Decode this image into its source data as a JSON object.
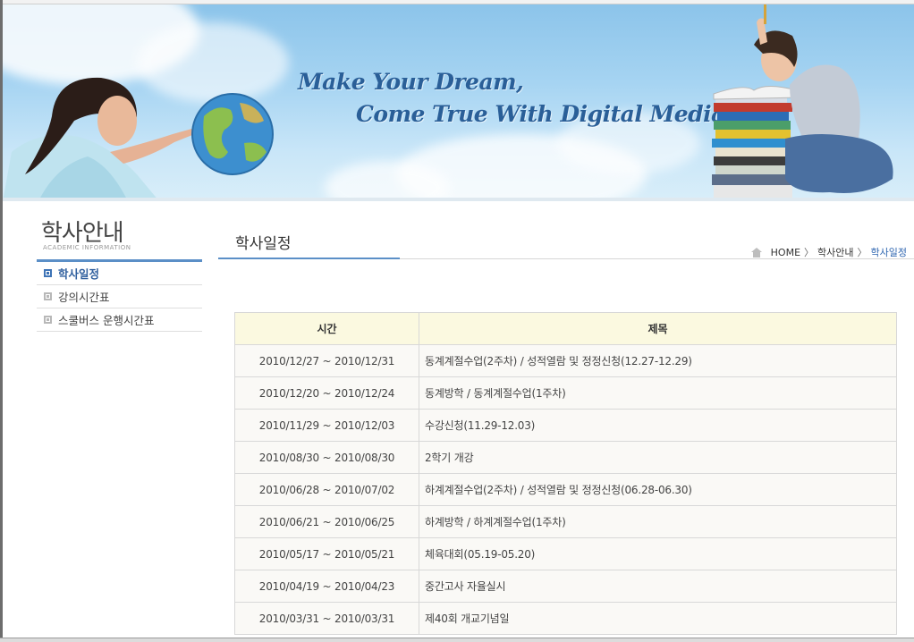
{
  "banner": {
    "slogan_line1": "Make Your Dream,",
    "slogan_line2": "Come True With Digital Media"
  },
  "sidebar": {
    "title": "학사안내",
    "subtitle": "ACADEMIC INFORMATION",
    "items": [
      {
        "label": "학사일정",
        "active": true
      },
      {
        "label": "강의시간표",
        "active": false
      },
      {
        "label": "스쿨버스 운행시간표",
        "active": false
      }
    ]
  },
  "page": {
    "title": "학사일정",
    "breadcrumb": [
      "HOME",
      "학사안내",
      "학사일정"
    ],
    "breadcrumb_separator": "〉"
  },
  "table": {
    "headers": [
      "시간",
      "제목"
    ],
    "rows": [
      {
        "date": "2010/12/27 ~ 2010/12/31",
        "title": "동계계절수업(2주차) / 성적열람 및 정정신청(12.27-12.29)"
      },
      {
        "date": "2010/12/20 ~ 2010/12/24",
        "title": "동계방학 / 동계계절수업(1주차)"
      },
      {
        "date": "2010/11/29 ~ 2010/12/03",
        "title": "수강신청(11.29-12.03)"
      },
      {
        "date": "2010/08/30 ~ 2010/08/30",
        "title": "2학기 개강"
      },
      {
        "date": "2010/06/28 ~ 2010/07/02",
        "title": "하계계절수업(2주차) / 성적열람 및 정정신청(06.28-06.30)"
      },
      {
        "date": "2010/06/21 ~ 2010/06/25",
        "title": "하계방학 / 하계계절수업(1주차)"
      },
      {
        "date": "2010/05/17 ~ 2010/05/21",
        "title": "체육대회(05.19-05.20)"
      },
      {
        "date": "2010/04/19 ~ 2010/04/23",
        "title": "중간고사 자율실시"
      },
      {
        "date": "2010/03/31 ~ 2010/03/31",
        "title": "제40회 개교기념일"
      }
    ]
  },
  "colors": {
    "accent": "#5b8fc7",
    "active_menu": "#2f5f9e",
    "table_header_bg": "#fbf9e0",
    "table_row_bg": "#faf9f6"
  },
  "icons": {
    "breadcrumb_home": "home-icon",
    "menu_bullet": "square-bullet-icon"
  }
}
